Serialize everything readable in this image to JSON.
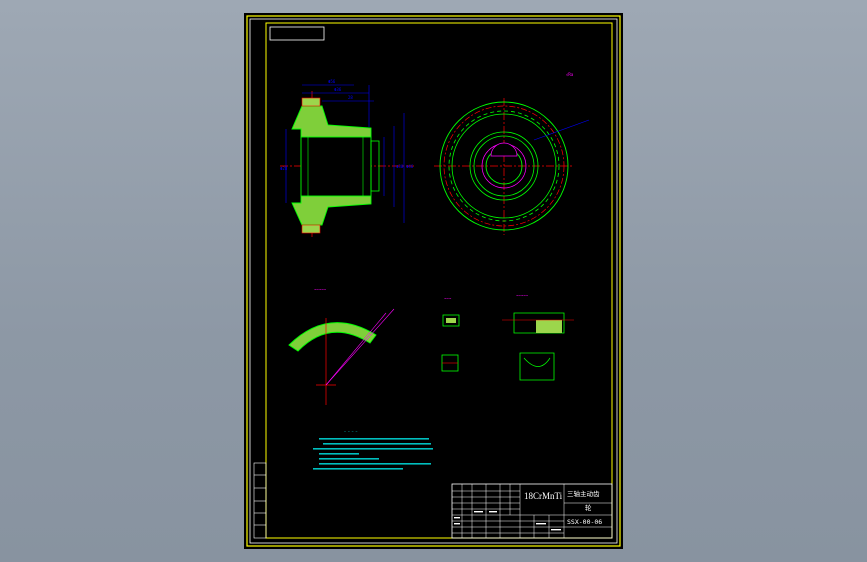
{
  "drawing": {
    "material": "18CrMnTi",
    "part_name_line1": "三轴主动齿",
    "part_name_line2": "轮",
    "drawing_number": "SSX-00-06"
  },
  "colors": {
    "background": "#000000",
    "frame": "#ffffff",
    "border": "#ffff00",
    "outline": "#00ff00",
    "hatch": "#00ff00",
    "centerline": "#ff0000",
    "dimension": "#0000ff",
    "annotation": "#ff00ff",
    "notes": "#00ffff",
    "part_fill": "#9cd64c"
  }
}
